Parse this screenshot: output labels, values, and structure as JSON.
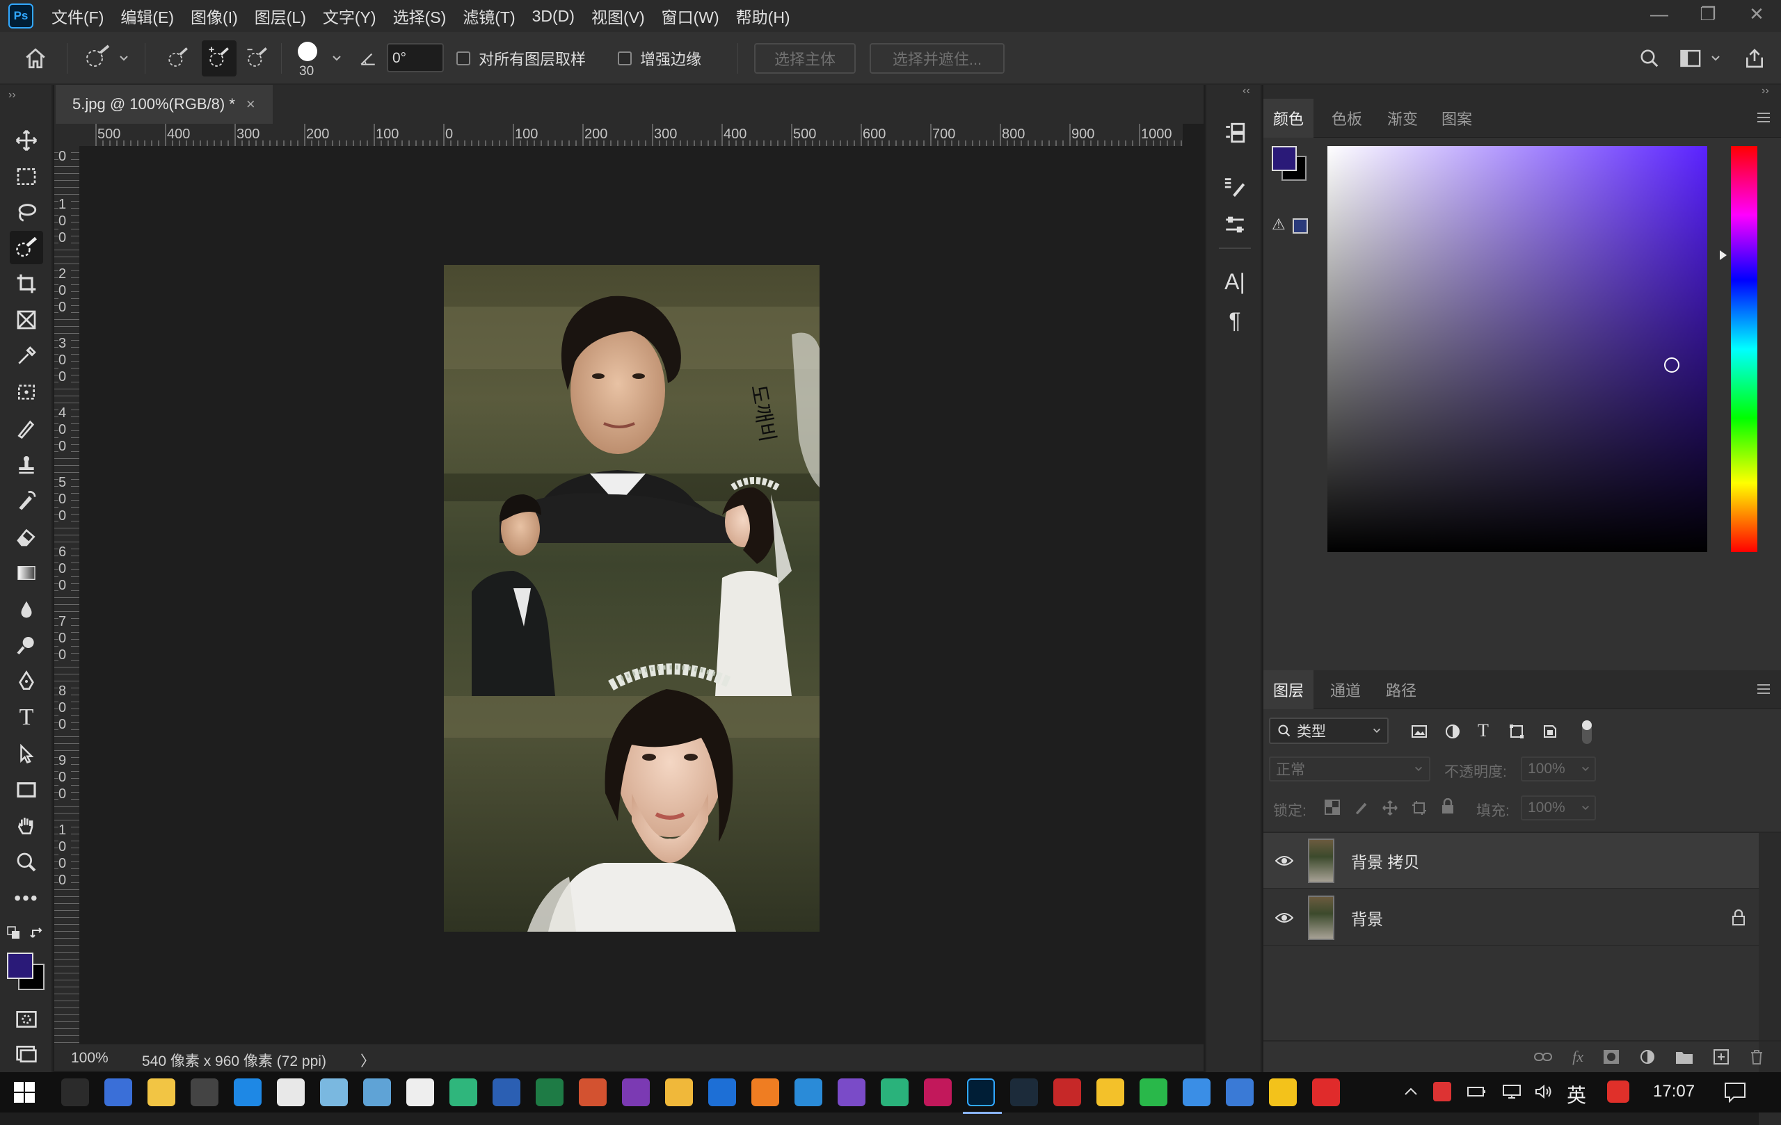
{
  "app": {
    "logo_text": "Ps"
  },
  "menu": [
    "文件(F)",
    "编辑(E)",
    "图像(I)",
    "图层(L)",
    "文字(Y)",
    "选择(S)",
    "滤镜(T)",
    "3D(D)",
    "视图(V)",
    "窗口(W)",
    "帮助(H)"
  ],
  "window_controls": {
    "minimize": "—",
    "restore": "❐",
    "close": "✕"
  },
  "options": {
    "brush_size": "30",
    "angle": "0°",
    "sample_all_layers": "对所有图层取样",
    "enhance_edge": "增强边缘",
    "select_subject": "选择主体",
    "select_and_mask": "选择并遮住..."
  },
  "document": {
    "tab_title": "5.jpg @ 100%(RGB/8) *",
    "close_icon": "×",
    "zoom": "100%",
    "info": "540 像素 x 960 像素 (72 ppi)",
    "info_arrow": "〉"
  },
  "rulers": {
    "h_labels": [
      "500",
      "400",
      "300",
      "200",
      "100",
      "0",
      "100",
      "200",
      "300",
      "400",
      "500",
      "600",
      "700",
      "800",
      "900",
      "1000"
    ],
    "v_labels": [
      "0",
      "100",
      "200",
      "300",
      "400",
      "500",
      "600",
      "700",
      "800",
      "900",
      "1000"
    ]
  },
  "photo": {
    "signature": "도깨비"
  },
  "color_panel": {
    "tabs": [
      "颜色",
      "色板",
      "渐变",
      "图案"
    ],
    "active_tab": 0,
    "foreground": "#2a1a78",
    "background": "#000000",
    "hue_color": "#5a22ff",
    "warning_icon": "⚠"
  },
  "layers_panel": {
    "tabs": [
      "图层",
      "通道",
      "路径"
    ],
    "active_tab": 0,
    "filter_kind": "类型",
    "blend_mode": "正常",
    "opacity_label": "不透明度:",
    "opacity_value": "100%",
    "lock_label": "锁定:",
    "fill_label": "填充:",
    "fill_value": "100%",
    "layers": [
      {
        "name": "背景 拷贝",
        "locked": false
      },
      {
        "name": "背景",
        "locked": true
      }
    ]
  },
  "taskbar": {
    "time": "17:07",
    "ime": "英",
    "apps": [
      "terminal",
      "remote-desktop",
      "explorer",
      "calculator",
      "edge",
      "chrome",
      "notes",
      "paint",
      "typora",
      "mindmaster",
      "word",
      "excel",
      "powerpoint",
      "onenote",
      "evernote",
      "devecostudio",
      "sublime",
      "vscode",
      "visual-studio",
      "pycharm",
      "intellij",
      "photoshop",
      "lightroom",
      "acrobat",
      "qq",
      "wechat",
      "feishu",
      "baidu-netdisk",
      "music",
      "netease-music"
    ]
  }
}
